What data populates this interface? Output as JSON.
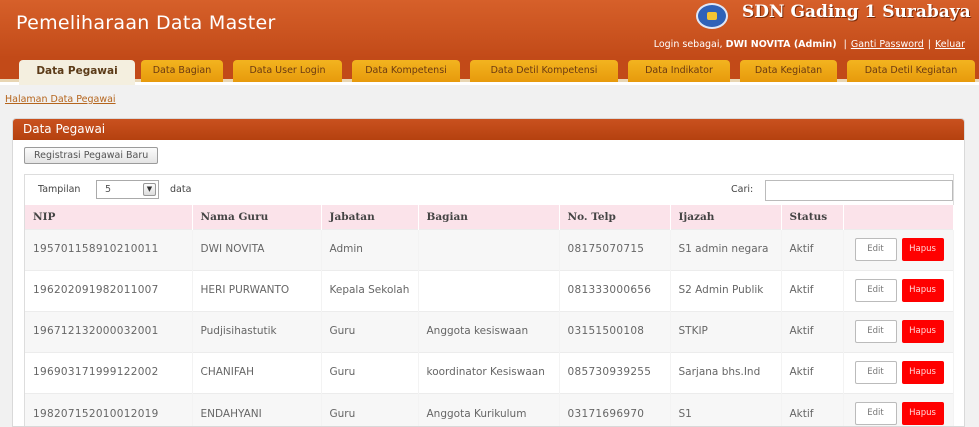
{
  "header": {
    "title": "Pemeliharaan Data Master",
    "school": "SDN Gading 1 Surabaya",
    "login_prefix": "Login sebagai,",
    "user": "DWI NOVITA (Admin)",
    "change_password": "Ganti Password",
    "separator": "|",
    "logout": "Keluar"
  },
  "tabs": [
    {
      "label": "Data Pegawai"
    },
    {
      "label": "Data Bagian"
    },
    {
      "label": "Data User Login"
    },
    {
      "label": "Data Kompetensi"
    },
    {
      "label": "Data Detil Kompetensi"
    },
    {
      "label": "Data Indikator"
    },
    {
      "label": "Data Kegiatan"
    },
    {
      "label": "Data Detil Kegiatan"
    }
  ],
  "breadcrumb": "Halaman Data Pegawai",
  "panel": {
    "title": "Data Pegawai",
    "register_button": "Registrasi Pegawai Baru"
  },
  "controls": {
    "show_label": "Tampilan",
    "show_value": "5",
    "show_suffix": "data",
    "search_label": "Cari:",
    "search_value": ""
  },
  "table": {
    "columns": [
      "NIP",
      "Nama Guru",
      "Jabatan",
      "Bagian",
      "No. Telp",
      "Ijazah",
      "Status",
      ""
    ],
    "edit_label": "Edit",
    "delete_label": "Hapus",
    "rows": [
      {
        "nip": "195701158910210011",
        "nama": "DWI NOVITA",
        "jabatan": "Admin",
        "bagian": "",
        "telp": "08175070715",
        "ijazah": "S1 admin negara",
        "status": "Aktif"
      },
      {
        "nip": "196202091982011007",
        "nama": "HERI PURWANTO",
        "jabatan": "Kepala Sekolah",
        "bagian": "",
        "telp": "081333000656",
        "ijazah": "S2 Admin Publik",
        "status": "Aktif"
      },
      {
        "nip": "196712132000032001",
        "nama": "Pudjisihastutik",
        "jabatan": "Guru",
        "bagian": "Anggota kesiswaan",
        "telp": "03151500108",
        "ijazah": "STKIP",
        "status": "Aktif"
      },
      {
        "nip": "196903171999122002",
        "nama": "CHANIFAH",
        "jabatan": "Guru",
        "bagian": "koordinator Kesiswaan",
        "telp": "085730939255",
        "ijazah": "Sarjana bhs.Ind",
        "status": "Aktif"
      },
      {
        "nip": "198207152010012019",
        "nama": "ENDAHYANI",
        "jabatan": "Guru",
        "bagian": "Anggota Kurikulum",
        "telp": "03171696970",
        "ijazah": "S1",
        "status": "Aktif"
      }
    ]
  }
}
